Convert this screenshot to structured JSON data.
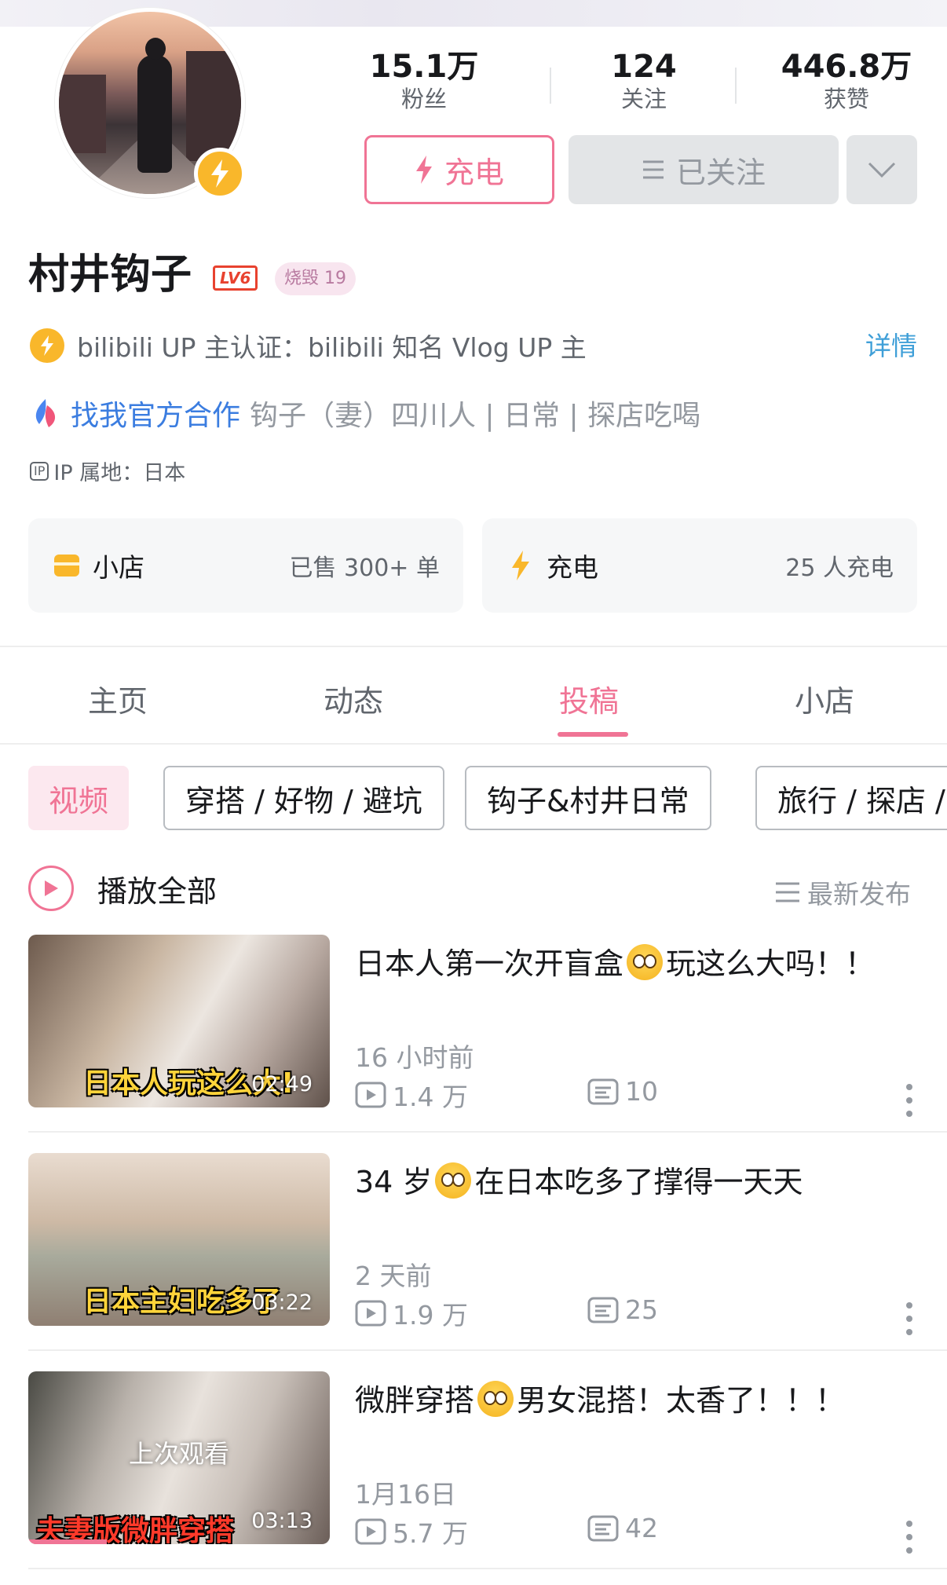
{
  "profile": {
    "name": "村井钩子",
    "level_badge": "LV6",
    "medal": "烧毁 19",
    "stats": [
      {
        "num": "15.1万",
        "label": "粉丝"
      },
      {
        "num": "124",
        "label": "关注"
      },
      {
        "num": "446.8万",
        "label": "获赞"
      }
    ],
    "charge_button": "充电",
    "followed_button": "已关注",
    "certification": "bilibili UP 主认证：bilibili 知名 Vlog UP 主",
    "detail_link": "详情",
    "coop_link": "找我官方合作",
    "coop_desc": "钩子（妻）四川人 | 日常 | 探店吃喝",
    "ip_tag": "IP",
    "ip_text": "IP 属地：日本"
  },
  "cards": {
    "shop": {
      "title": "小店",
      "sub": "已售 300+ 单"
    },
    "charge": {
      "title": "充电",
      "sub": "25 人充电"
    }
  },
  "tabs": [
    "主页",
    "动态",
    "投稿",
    "小店"
  ],
  "active_tab": "投稿",
  "chips": [
    "视频",
    "穿搭 / 好物 / 避坑",
    "钩子&村井日常",
    "旅行 / 探店 /"
  ],
  "play_all": "播放全部",
  "sort_label": "最新发布",
  "videos": [
    {
      "title_a": "日本人第一次开盲盒",
      "title_b": "玩这么大吗！！",
      "time": "16 小时前",
      "plays": "1.4 万",
      "danmu": "10",
      "duration": "02:49",
      "caption": "日本人玩这么大!"
    },
    {
      "title_a": "34 岁",
      "title_b": "在日本吃多了撑得一天天",
      "time": "2 天前",
      "plays": "1.9 万",
      "danmu": "25",
      "duration": "03:22",
      "caption": "日本主妇吃多了"
    },
    {
      "title_a": "微胖穿搭",
      "title_b": "男女混搭！太香了！！！",
      "time": "1月16日",
      "plays": "5.7 万",
      "danmu": "42",
      "duration": "03:13",
      "caption": "夫妻版微胖穿搭",
      "watched": "上次观看"
    }
  ],
  "colors": {
    "accent": "#f07495",
    "link": "#3b7de0",
    "gold": "#f9b72b"
  }
}
